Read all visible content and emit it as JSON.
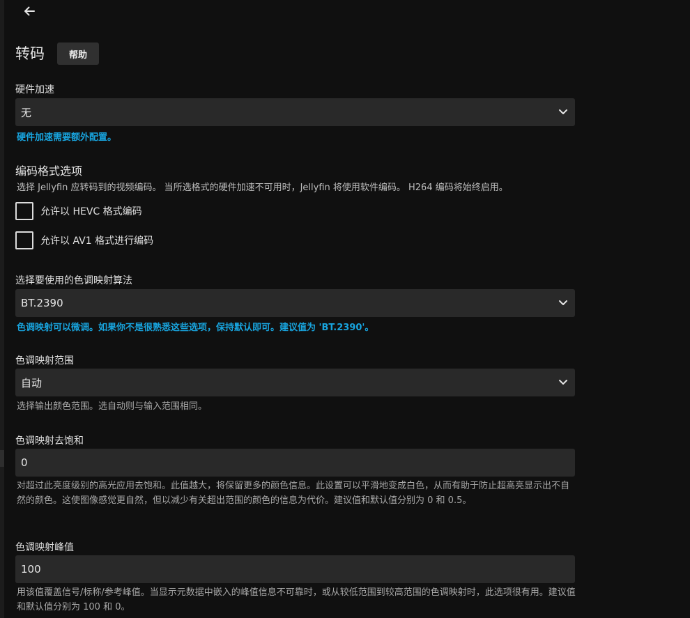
{
  "header": {
    "title": "转码",
    "help_label": "帮助"
  },
  "hardware_acceleration": {
    "label": "硬件加速",
    "value": "无",
    "hint": "硬件加速需要额外配置。"
  },
  "encoding_formats": {
    "title": "编码格式选项",
    "description": "选择 Jellyfin 应转码到的视频编码。 当所选格式的硬件加速不可用时，Jellyfin 将使用软件编码。 H264 编码将始终启用。",
    "options": [
      {
        "label": "允许以 HEVC 格式编码",
        "checked": false
      },
      {
        "label": "允许以 AV1 格式进行编码",
        "checked": false
      }
    ]
  },
  "tonemap_algorithm": {
    "label": "选择要使用的色调映射算法",
    "value": "BT.2390",
    "hint": "色调映射可以微调。如果你不是很熟悉这些选项，保持默认即可。建议值为 'BT.2390'。"
  },
  "tonemap_range": {
    "label": "色调映射范围",
    "value": "自动",
    "hint": "选择输出颜色范围。选自动则与输入范围相同。"
  },
  "tonemap_desat": {
    "label": "色调映射去饱和",
    "value": "0",
    "hint": "对超过此亮度级别的高光应用去饱和。此值越大，将保留更多的颜色信息。此设置可以平滑地变成白色，从而有助于防止超高亮显示出不自然的颜色。这使图像感觉更自然，但以减少有关超出范围的颜色的信息为代价。建议值和默认值分别为 0 和 0.5。"
  },
  "tonemap_peak": {
    "label": "色调映射峰值",
    "value": "100",
    "hint": "用该值覆盖信号/标称/参考峰值。当显示元数据中嵌入的峰值信息不可靠时，或从较低范围到较高范围的色调映射时，此选项很有用。建议值和默认值分别为 100 和 0。"
  },
  "colors": {
    "background": "#101010",
    "field": "#292929",
    "accent": "#18a4de"
  }
}
